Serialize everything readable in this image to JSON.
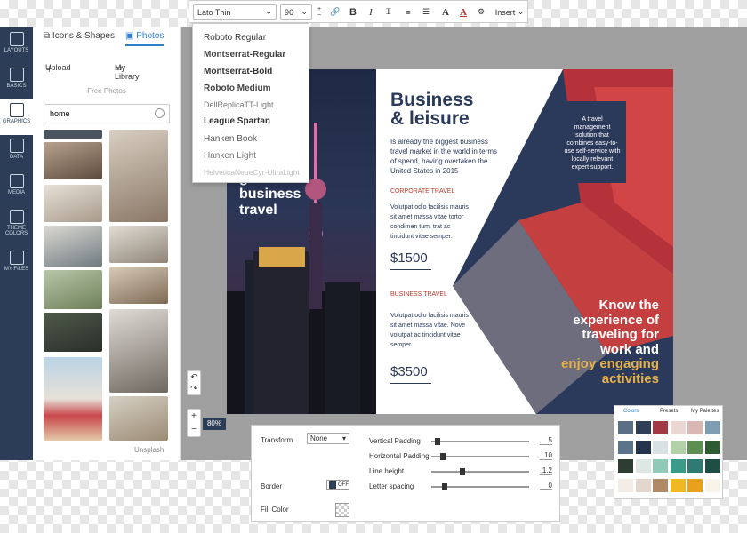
{
  "sidebar": {
    "items": [
      {
        "label": "LAYOUTS"
      },
      {
        "label": "BASICS"
      },
      {
        "label": "GRAPHICS"
      },
      {
        "label": "DATA"
      },
      {
        "label": "MEDIA"
      },
      {
        "label": "THEME COLORS"
      },
      {
        "label": "MY FILES"
      }
    ]
  },
  "panel": {
    "tab_icons": "Icons & Shapes",
    "tab_photos": "Photos",
    "upload": "Upload",
    "library": "My Library",
    "section": "Free Photos",
    "search_value": "home",
    "credit": "Unsplash"
  },
  "toolbar": {
    "font": "Lato Thin",
    "size": "96",
    "insert": "Insert"
  },
  "font_menu": [
    "Roboto Regular",
    "Montserrat-Regular",
    "Montserrat-Bold",
    "Roboto Medium",
    "DellReplicaTT-Light",
    "League Spartan",
    "Hanken Book",
    "Hanken Light",
    "HelveticaNeueCyr-UltraLight"
  ],
  "design": {
    "cover_line1": "global",
    "cover_line2": "business",
    "cover_line3": "travel",
    "headline1": "Business",
    "headline2": "& leisure",
    "intro": "Is already the biggest business travel market in the world in terms of spend, having overtaken the United States in 2015",
    "section1": "CORPORATE TRAVEL",
    "body1": "Volutpat odio facilisis mauris sit amet massa vitae tortor condimen tum. trat ac tincidunt vitae semper.",
    "price1": "$1500",
    "section2": "BUSINESS TRAVEL",
    "body2": "Volutpat odio facilisis mauris sit amet massa vitae. Nove volutpat ac tincidunt vitae semper.",
    "price2": "$3500",
    "box_text": "A travel management solution that combines easy-to-use self-service with locally relevant expert support.",
    "know1": "Know the",
    "know2": "experience of",
    "know3": "traveling for",
    "know4": "work and",
    "know5": "enjoy engaging",
    "know6": "activities"
  },
  "zoom": {
    "value": "80%"
  },
  "props": {
    "transform_label": "Transform",
    "transform_value": "None",
    "border_label": "Border",
    "border_toggle": "OFF",
    "fill_label": "Fill Color",
    "vpad_label": "Vertical Padding",
    "vpad_value": "5",
    "hpad_label": "Horizontal Padding",
    "hpad_value": "10",
    "lh_label": "Line height",
    "lh_value": "1.2",
    "ls_label": "Letter spacing",
    "ls_value": "0"
  },
  "colors_panel": {
    "tab_colors": "Colors",
    "tab_presets": "Presets",
    "tab_palettes": "My Palettes",
    "swatches": [
      "#5a6f86",
      "#2e3e56",
      "#a13a44",
      "#ead7d3",
      "#d9b7b3",
      "#7e9db1",
      "#5b7489",
      "#24344c",
      "#d7e1e4",
      "#b3d1a7",
      "#5d8f53",
      "#2e5b33",
      "#2e3d32",
      "#dde8e4",
      "#8fcab9",
      "#3a9b8a",
      "#2f7b73",
      "#1f4e45",
      "#f4ece6",
      "#e3d6cd",
      "#b08967",
      "#f0b821",
      "#e7a11a",
      "#f8f4ea"
    ]
  }
}
